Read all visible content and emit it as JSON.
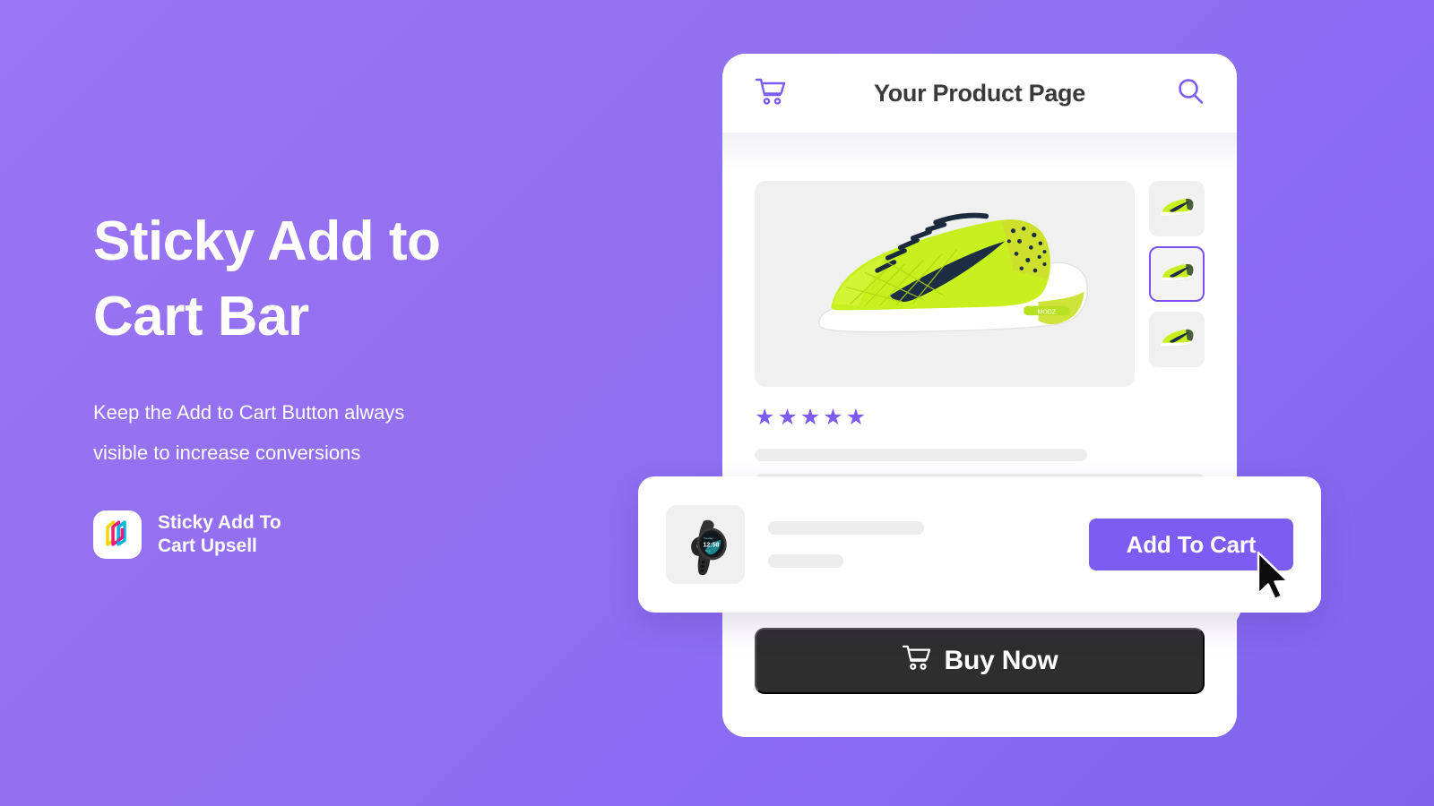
{
  "theme": {
    "bg_gradient_from": "#9a76f5",
    "bg_gradient_to": "#7e63ed",
    "accent": "#7c5cf2",
    "accent_dark": "#7c4ff0",
    "buy_now_bg": "#2e2e2e",
    "skeleton": "#ededed",
    "panel_bg": "#f0f0f0",
    "text_dark": "#3a3a3a",
    "white": "#ffffff"
  },
  "promo": {
    "title_line1": "Sticky Add to",
    "title_line2": "Cart Bar",
    "subtitle": "Keep the Add to Cart Button always visible to increase conversions",
    "brand_logo_icon": "layered-books-logo-icon",
    "brand_name": "Sticky Add To\nCart Upsell"
  },
  "phone": {
    "header": {
      "cart_icon": "shopping-cart-icon",
      "title": "Your Product Page",
      "search_icon": "search-icon"
    },
    "gallery": {
      "main_image_alt": "neon-green-running-shoe",
      "thumbnails": [
        {
          "alt": "shoe-thumbnail-1",
          "selected": false
        },
        {
          "alt": "shoe-thumbnail-2",
          "selected": true
        },
        {
          "alt": "shoe-thumbnail-3",
          "selected": false
        }
      ]
    },
    "rating": {
      "stars_filled": 5,
      "star_glyph": "★"
    },
    "description_placeholders": 4,
    "buy_now": {
      "icon": "shopping-cart-icon",
      "label": "Buy Now"
    }
  },
  "sticky_bar": {
    "product_thumb_alt": "black-smart-watch",
    "line_placeholders": 2,
    "add_to_cart_label": "Add To Cart",
    "cursor_icon": "mouse-pointer-icon"
  }
}
